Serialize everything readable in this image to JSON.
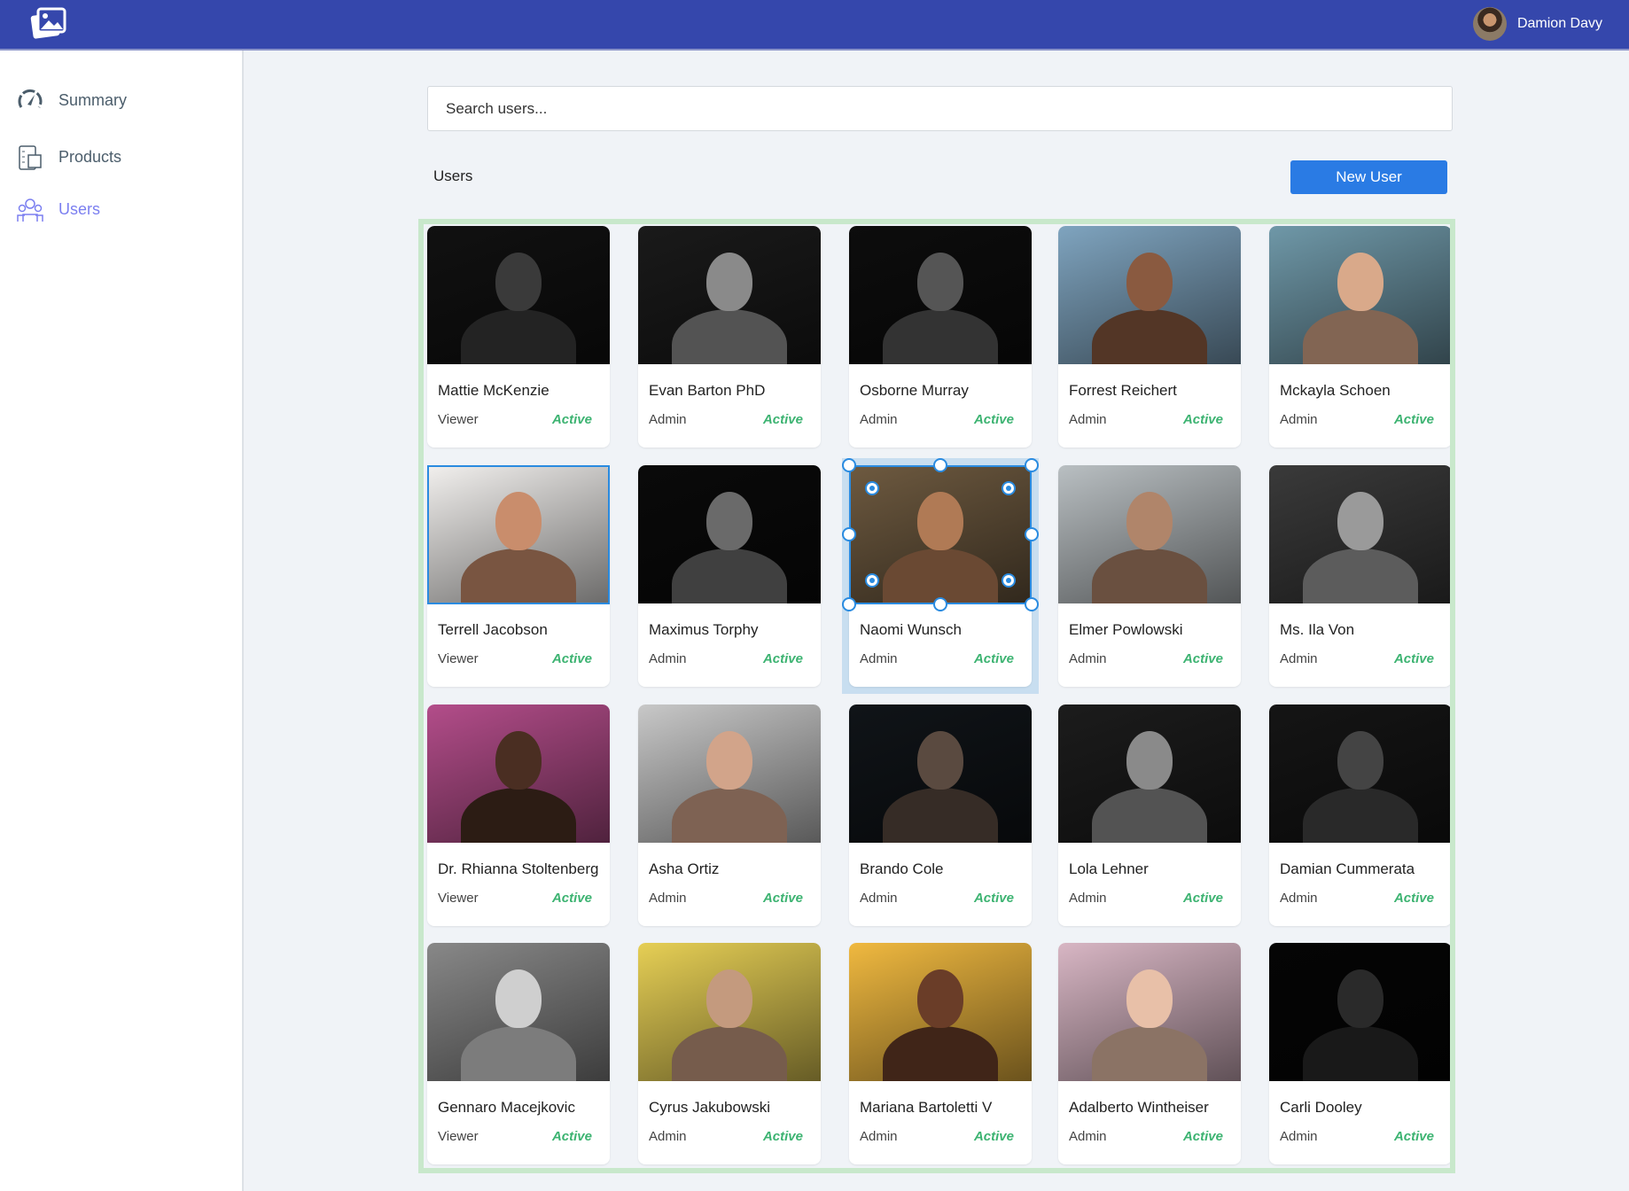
{
  "header": {
    "user_name": "Damion Davy"
  },
  "sidebar": {
    "items": [
      {
        "label": "Summary",
        "icon": "speedometer-icon"
      },
      {
        "label": "Products",
        "icon": "clipboard-icon"
      },
      {
        "label": "Users",
        "icon": "users-icon",
        "active": true
      }
    ]
  },
  "search": {
    "placeholder": "Search users..."
  },
  "section_title": "Users",
  "new_user_label": "New User",
  "users": [
    {
      "name": "Mattie McKenzie",
      "role": "Viewer",
      "status": "Active",
      "bg": "#111111",
      "skin": "#3a3a3a"
    },
    {
      "name": "Evan Barton PhD",
      "role": "Admin",
      "status": "Active",
      "bg": "#1a1a1a",
      "skin": "#8a8a8a"
    },
    {
      "name": "Osborne Murray",
      "role": "Admin",
      "status": "Active",
      "bg": "#0d0d0d",
      "skin": "#555555"
    },
    {
      "name": "Forrest Reichert",
      "role": "Admin",
      "status": "Active",
      "bg": "#7fa4bf",
      "skin": "#8a5a40"
    },
    {
      "name": "Mckayla Schoen",
      "role": "Admin",
      "status": "Active",
      "bg": "#6f98a8",
      "skin": "#d9a98a"
    },
    {
      "name": "Terrell Jacobson",
      "role": "Viewer",
      "status": "Active",
      "bg": "#f2f0ee",
      "skin": "#c98d6c"
    },
    {
      "name": "Maximus Torphy",
      "role": "Admin",
      "status": "Active",
      "bg": "#0a0a0a",
      "skin": "#6a6a6a"
    },
    {
      "name": "Naomi Wunsch",
      "role": "Admin",
      "status": "Active",
      "bg": "#6e5a40",
      "skin": "#b07a55"
    },
    {
      "name": "Elmer Powlowski",
      "role": "Admin",
      "status": "Active",
      "bg": "#b9bfc2",
      "skin": "#b0856a"
    },
    {
      "name": "Ms. Ila Von",
      "role": "Admin",
      "status": "Active",
      "bg": "#3a3a3a",
      "skin": "#9a9a9a"
    },
    {
      "name": "Dr. Rhianna Stoltenberg",
      "role": "Viewer",
      "status": "Active",
      "bg": "#b34d8a",
      "skin": "#4a2e22"
    },
    {
      "name": "Asha Ortiz",
      "role": "Admin",
      "status": "Active",
      "bg": "#c8c8c8",
      "skin": "#d2a48a"
    },
    {
      "name": "Brando Cole",
      "role": "Admin",
      "status": "Active",
      "bg": "#101418",
      "skin": "#5a4a40"
    },
    {
      "name": "Lola Lehner",
      "role": "Admin",
      "status": "Active",
      "bg": "#1c1c1c",
      "skin": "#8a8a8a"
    },
    {
      "name": "Damian Cummerata",
      "role": "Admin",
      "status": "Active",
      "bg": "#151515",
      "skin": "#444444"
    },
    {
      "name": "Gennaro Macejkovic",
      "role": "Viewer",
      "status": "Active",
      "bg": "#888888",
      "skin": "#cfcfcf"
    },
    {
      "name": "Cyrus Jakubowski",
      "role": "Admin",
      "status": "Active",
      "bg": "#e6cf55",
      "skin": "#c49a7e"
    },
    {
      "name": "Mariana Bartoletti V",
      "role": "Admin",
      "status": "Active",
      "bg": "#f0b940",
      "skin": "#6a3d28"
    },
    {
      "name": "Adalberto Wintheiser",
      "role": "Admin",
      "status": "Active",
      "bg": "#d8b6c4",
      "skin": "#e8c0a8"
    },
    {
      "name": "Carli Dooley",
      "role": "Admin",
      "status": "Active",
      "bg": "#050505",
      "skin": "#2a2a2a"
    }
  ]
}
